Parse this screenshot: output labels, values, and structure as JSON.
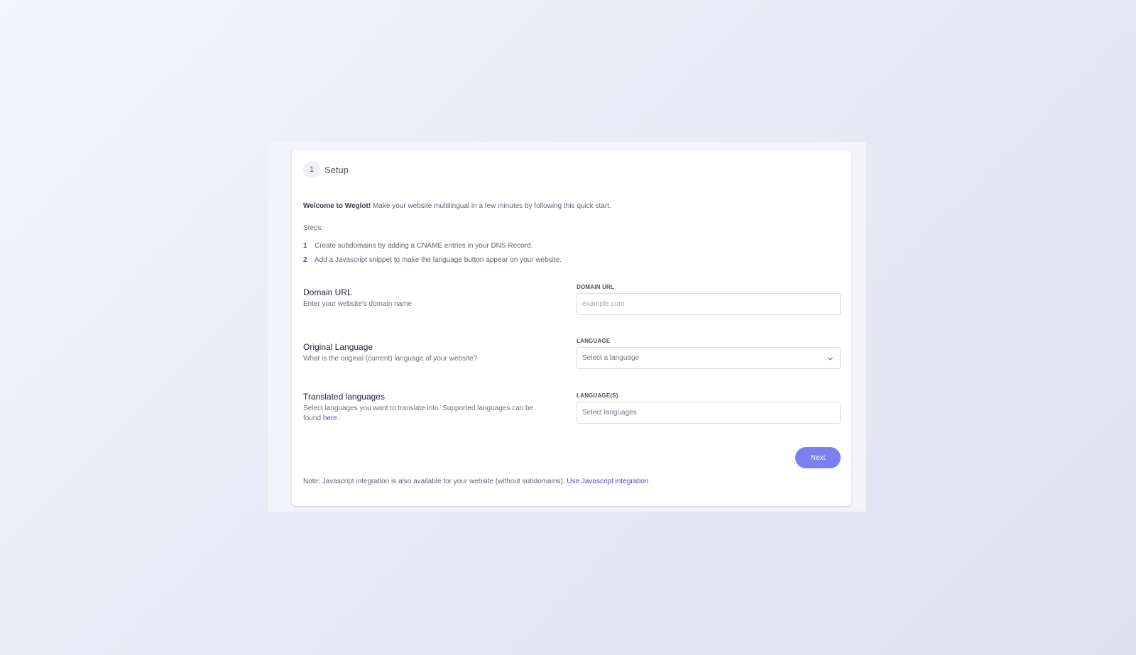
{
  "setup": {
    "step_number": "1",
    "step_title": "Setup"
  },
  "intro": {
    "welcome_bold": "Welcome to Weglot!",
    "welcome_text": " Make your website multilingual in a few minutes by following this quick start.",
    "steps_label": "Steps:",
    "steps": [
      {
        "num": "1",
        "text": "Create subdomains by adding a CNAME entries in your DNS Record."
      },
      {
        "num": "2",
        "text": "Add a Javascript snippet to make the language button appear on your website."
      }
    ]
  },
  "domain": {
    "title": "Domain URL",
    "description": "Enter your website's domain name",
    "field_label": "DOMAIN URL",
    "placeholder": "example.com"
  },
  "original_language": {
    "title": "Original Language",
    "description": "What is the original (current) language of your website?",
    "field_label": "LANGUAGE",
    "select_value": "Select a language"
  },
  "translated_languages": {
    "title": "Translated languages",
    "description": "Select languages you want to translate into. Supported languages can be found ",
    "link_text": "here",
    "link_suffix": ".",
    "field_label": "LANGUAGE(S)",
    "select_value": "Select languages"
  },
  "actions": {
    "next_label": "Next"
  },
  "note": {
    "text": "Note: Javascript integration is also available for your website (without subdomains). ",
    "link_text": "Use Javascript integration"
  },
  "icons": {
    "dropdown": "chevron-down-icon"
  },
  "colors": {
    "accent": "#4f46e5",
    "button": "#7c7ff0"
  }
}
